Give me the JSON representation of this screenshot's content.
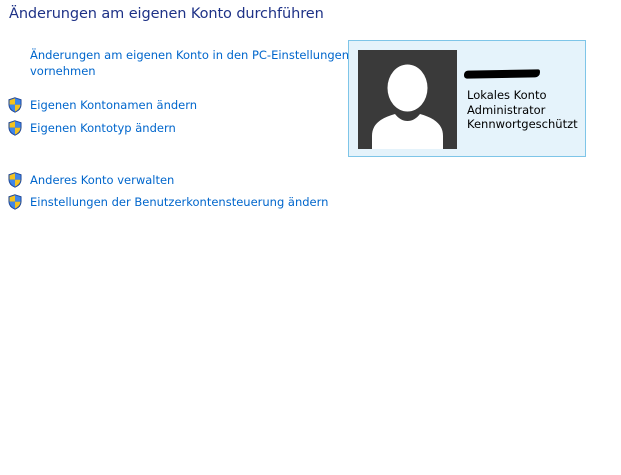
{
  "page": {
    "title": "Änderungen am eigenen Konto durchführen"
  },
  "tasks": {
    "pc_settings_line1": "Änderungen am eigenen Konto in den PC-Einstellungen",
    "pc_settings_line2": "vornehmen",
    "change_name": "Eigenen Kontonamen ändern",
    "change_type": "Eigenen Kontotyp ändern",
    "manage_other": "Anderes Konto verwalten",
    "uac_settings": "Einstellungen der Benutzerkontensteuerung ändern"
  },
  "account": {
    "type": "Lokales Konto",
    "role": "Administrator",
    "protection": "Kennwortgeschützt"
  },
  "colors": {
    "title": "#1e3287",
    "link": "#0066cc",
    "card_background": "#e5f3fb",
    "card_border": "#7ec5e8",
    "avatar_background": "#3a3a3a"
  },
  "icons": {
    "uac": "uac-shield-icon",
    "avatar": "user-avatar-icon"
  }
}
